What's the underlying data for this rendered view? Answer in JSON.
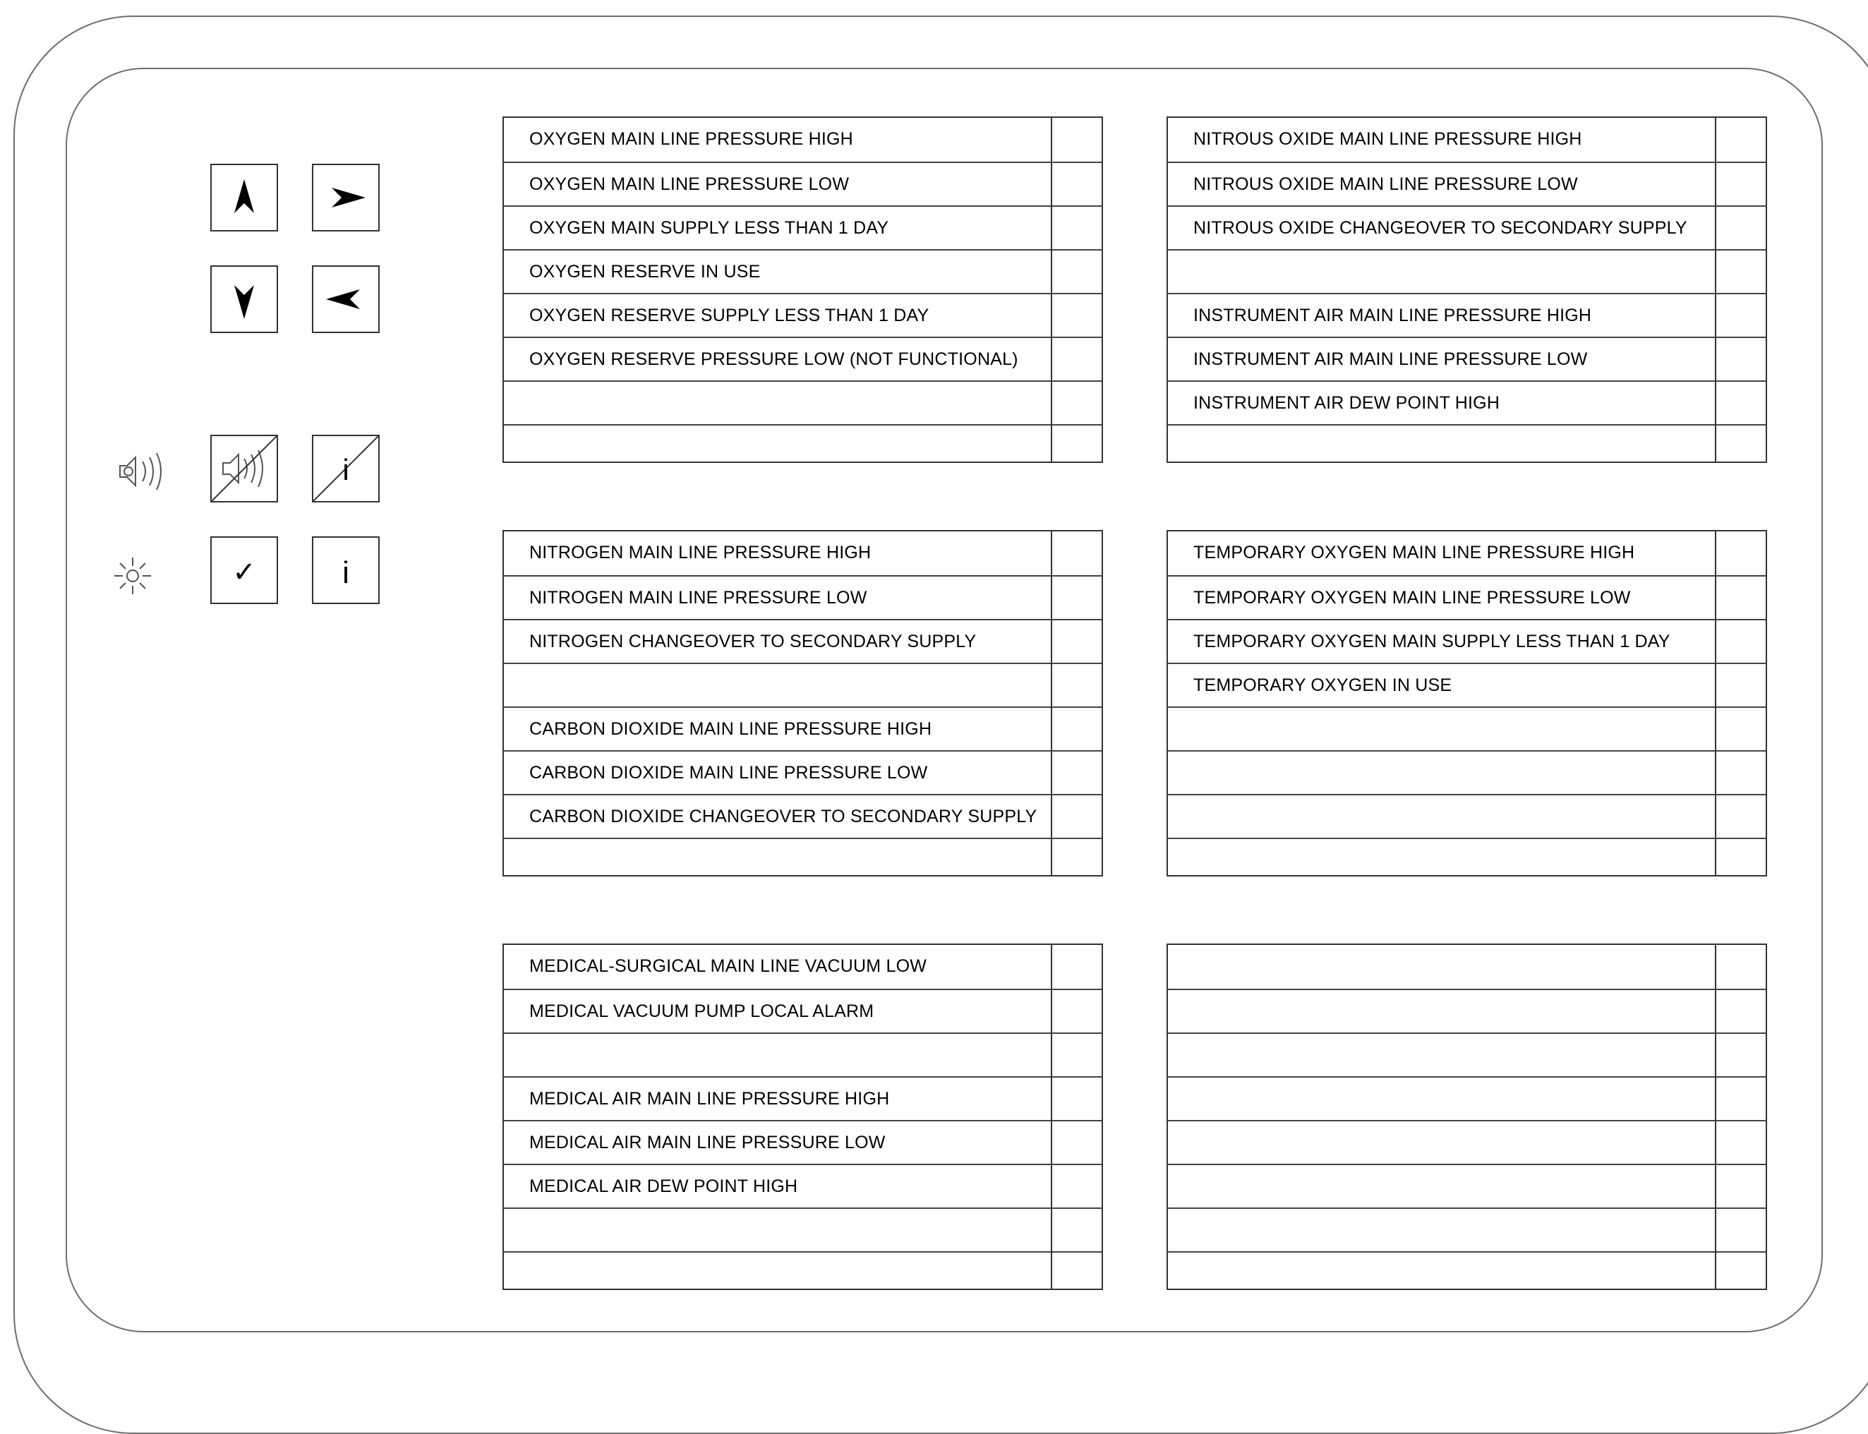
{
  "controls": {
    "nav_buttons": [
      {
        "name": "up-arrow-button",
        "icon": "up-arrow-icon"
      },
      {
        "name": "right-arrow-button",
        "icon": "right-arrow-icon"
      },
      {
        "name": "down-arrow-button",
        "icon": "down-arrow-icon"
      },
      {
        "name": "left-arrow-button",
        "icon": "left-arrow-icon"
      }
    ],
    "audio_row": {
      "indicator_icon": "speaker-icon",
      "buttons": [
        "mute-audio-button",
        "info-off-button"
      ]
    },
    "light_row": {
      "indicator_icon": "lamp-icon",
      "buttons": [
        "acknowledge-button",
        "info-button"
      ]
    },
    "info_glyph": "i",
    "check_glyph": "✓"
  },
  "panels": [
    {
      "rows": [
        "OXYGEN MAIN LINE PRESSURE HIGH",
        "OXYGEN MAIN LINE PRESSURE LOW",
        "OXYGEN MAIN SUPPLY LESS THAN 1 DAY",
        "OXYGEN RESERVE IN USE",
        "OXYGEN RESERVE SUPPLY LESS THAN 1 DAY",
        "OXYGEN RESERVE PRESSURE LOW (NOT FUNCTIONAL)",
        "",
        ""
      ]
    },
    {
      "rows": [
        "NITROUS OXIDE MAIN LINE PRESSURE HIGH",
        "NITROUS OXIDE MAIN LINE PRESSURE LOW",
        "NITROUS OXIDE CHANGEOVER TO SECONDARY SUPPLY",
        "",
        "INSTRUMENT AIR MAIN LINE PRESSURE HIGH",
        "INSTRUMENT AIR MAIN LINE PRESSURE LOW",
        "INSTRUMENT AIR DEW POINT HIGH",
        ""
      ]
    },
    {
      "rows": [
        "NITROGEN MAIN LINE PRESSURE HIGH",
        "NITROGEN MAIN LINE PRESSURE LOW",
        "NITROGEN CHANGEOVER TO SECONDARY SUPPLY",
        "",
        "CARBON DIOXIDE MAIN LINE PRESSURE HIGH",
        "CARBON DIOXIDE MAIN LINE PRESSURE LOW",
        "CARBON DIOXIDE CHANGEOVER TO SECONDARY SUPPLY",
        ""
      ]
    },
    {
      "rows": [
        "TEMPORARY OXYGEN MAIN LINE PRESSURE HIGH",
        "TEMPORARY OXYGEN MAIN LINE PRESSURE LOW",
        "TEMPORARY OXYGEN MAIN SUPPLY LESS THAN 1 DAY",
        "TEMPORARY OXYGEN IN USE",
        "",
        "",
        "",
        ""
      ]
    },
    {
      "rows": [
        "MEDICAL-SURGICAL MAIN LINE VACUUM LOW",
        "MEDICAL VACUUM PUMP LOCAL ALARM",
        "",
        "MEDICAL AIR MAIN LINE PRESSURE HIGH",
        "MEDICAL AIR MAIN LINE PRESSURE LOW",
        "MEDICAL AIR DEW POINT HIGH",
        "",
        ""
      ]
    },
    {
      "rows": [
        "",
        "",
        "",
        "",
        "",
        "",
        "",
        ""
      ]
    }
  ]
}
